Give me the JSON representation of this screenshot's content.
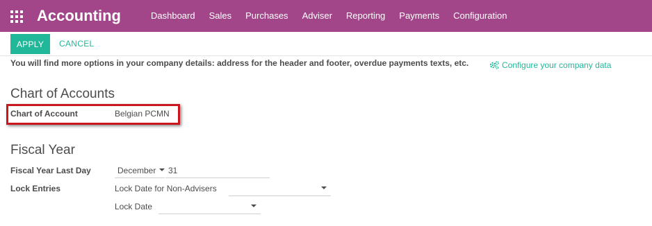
{
  "header": {
    "app_title": "Accounting",
    "menu": [
      "Dashboard",
      "Sales",
      "Purchases",
      "Adviser",
      "Reporting",
      "Payments",
      "Configuration"
    ]
  },
  "actions": {
    "apply": "APPLY",
    "cancel": "CANCEL"
  },
  "info": {
    "text": "You will find more options in your company details: address for the header and footer, overdue payments texts, etc.",
    "link": "Configure your company data"
  },
  "chart_of_accounts": {
    "title": "Chart of Accounts",
    "label": "Chart of Account",
    "value": "Belgian PCMN"
  },
  "fiscal_year": {
    "title": "Fiscal Year",
    "last_day_label": "Fiscal Year Last Day",
    "month": "December",
    "day": "31",
    "lock_label": "Lock Entries",
    "lock_non_advisers_label": "Lock Date for Non-Advisers",
    "lock_non_advisers_value": "",
    "lock_date_label": "Lock Date",
    "lock_date_value": ""
  },
  "colors": {
    "brand": "#a24689",
    "accent": "#21b799",
    "highlight": "#c8171e"
  },
  "icons": {
    "apps": "grid-icon",
    "config": "gears-icon"
  }
}
